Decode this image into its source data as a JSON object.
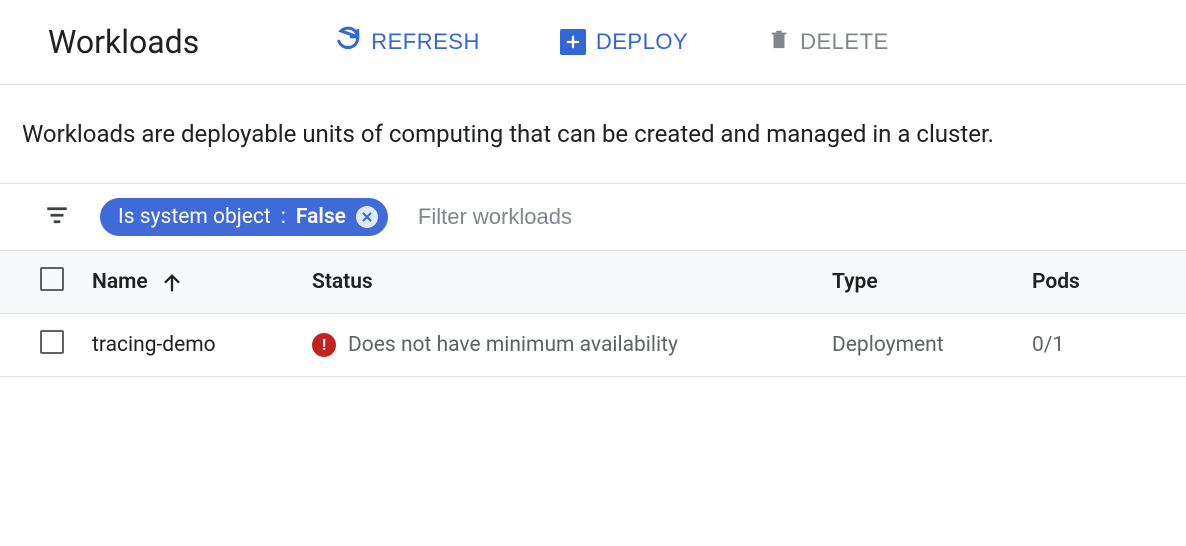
{
  "header": {
    "title": "Workloads",
    "actions": {
      "refresh": "REFRESH",
      "deploy": "DEPLOY",
      "delete": "DELETE"
    }
  },
  "description": "Workloads are deployable units of computing that can be created and managed in a cluster.",
  "filter": {
    "chip": {
      "key": "Is system object",
      "value": "False"
    },
    "placeholder": "Filter workloads"
  },
  "table": {
    "columns": {
      "name": "Name",
      "status": "Status",
      "type": "Type",
      "pods": "Pods"
    },
    "sort": {
      "column": "name",
      "dir": "asc"
    },
    "rows": [
      {
        "name": "tracing-demo",
        "status_icon": "error",
        "status_text": "Does not have minimum availability",
        "type": "Deployment",
        "pods": "0/1"
      }
    ]
  },
  "colors": {
    "action_blue": "#3367d6",
    "chip_blue": "#3f6ad8",
    "error_red": "#c5221f",
    "muted": "#80868b"
  }
}
